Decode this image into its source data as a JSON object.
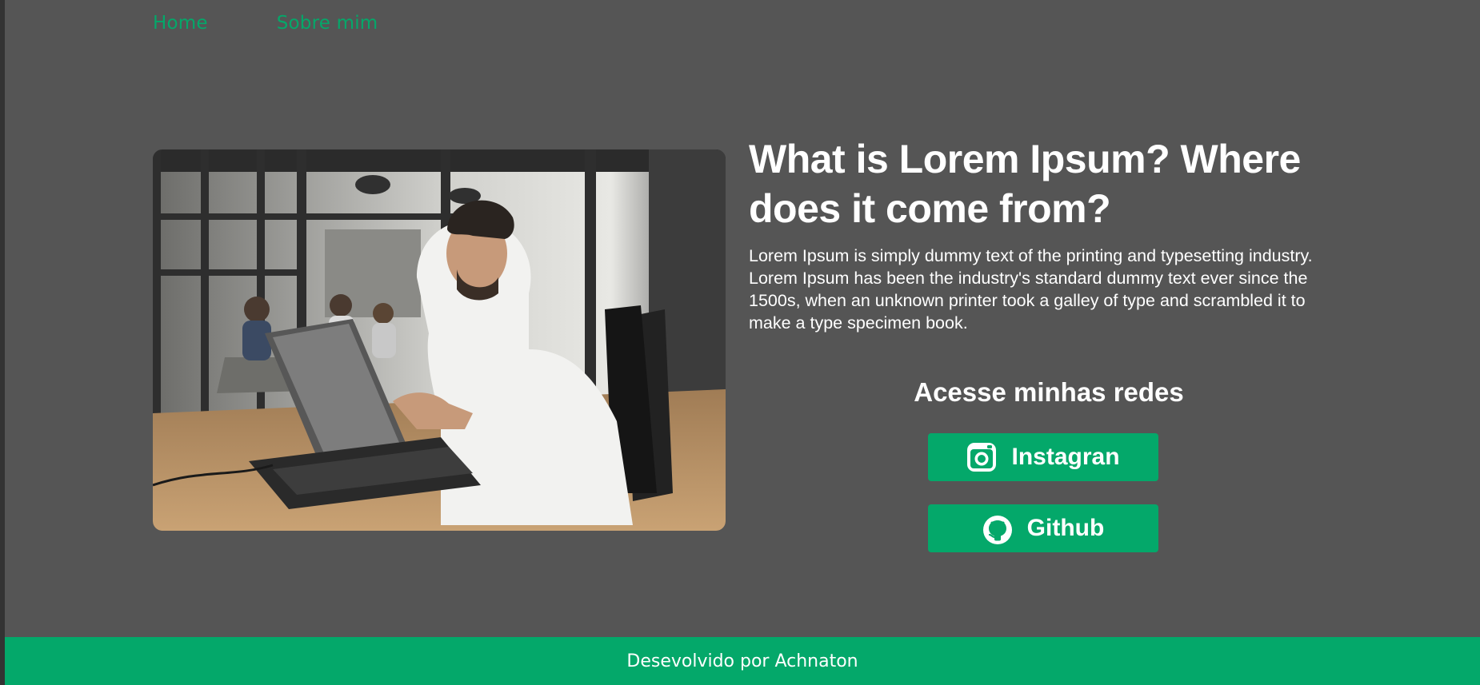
{
  "nav": {
    "items": [
      {
        "label": "Home"
      },
      {
        "label": "Sobre mim"
      }
    ]
  },
  "hero": {
    "title": "What is Lorem Ipsum? Where does it come from?",
    "description": "Lorem Ipsum is simply dummy text of the printing and typesetting industry. Lorem Ipsum has been the industry's standard dummy text ever since the 1500s, when an unknown printer took a galley of type and scrambled it to make a type specimen book."
  },
  "social": {
    "title": "Acesse minhas redes",
    "buttons": [
      {
        "label": "Instagran",
        "icon": "instagram-icon"
      },
      {
        "label": "Github",
        "icon": "github-icon"
      }
    ]
  },
  "footer": {
    "text": "Desevolvido por Achnaton"
  },
  "colors": {
    "accent": "#04a86a",
    "background": "#555555",
    "text": "#ffffff"
  }
}
